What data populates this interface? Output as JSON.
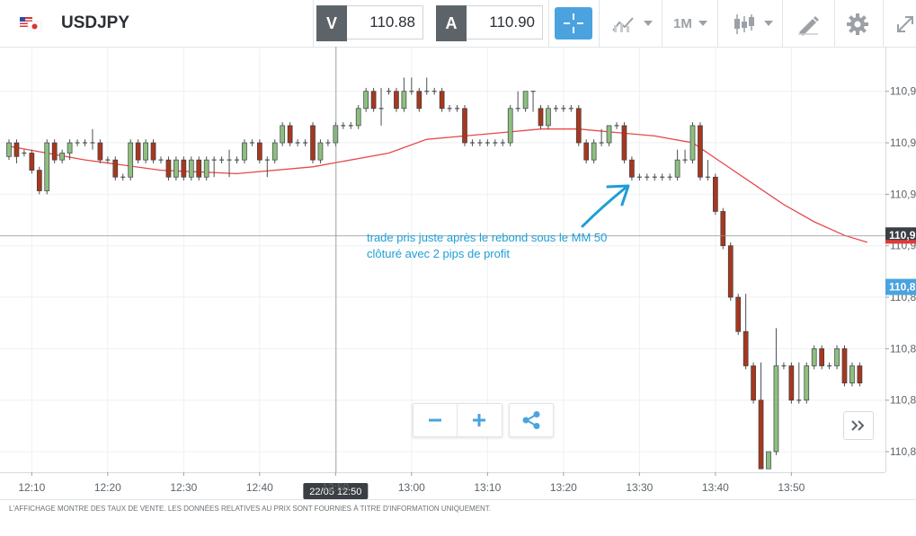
{
  "header": {
    "symbol": "USDJPY",
    "flag_icon": "us-jp-flag-icon",
    "sell": {
      "key": "V",
      "value": "110.88"
    },
    "buy": {
      "key": "A",
      "value": "110.90"
    },
    "timeframe": "1M",
    "icons": [
      "crosshair-icon",
      "indicators-icon",
      "candlestick-type-icon",
      "draw-icon",
      "gear-icon",
      "expand-icon"
    ]
  },
  "colors": {
    "accent": "#4aa3df",
    "bull": "#8fbf7f",
    "bear": "#a8371e",
    "ma": "#e8484a",
    "current_price": "#e53935",
    "annotation": "#1d9ed6"
  },
  "annotation": {
    "line1": "trade pris juste après le rebond sous le MM 50",
    "line2": "clôturé avec 2 pips de profit"
  },
  "crosshair": {
    "label": "22/05 12:50"
  },
  "price_tags": {
    "current": "110,9",
    "blue": "110,8"
  },
  "footer": {
    "disclaimer": "L'AFFICHAGE MONTRE DES TAUX DE VENTE. LES DONNÉES RELATIVES AU PRIX SONT FOURNIES À TITRE D'INFORMATION UNIQUEMENT."
  },
  "chart_data": {
    "type": "candlestick",
    "x_ticks": [
      "12:10",
      "12:20",
      "12:30",
      "12:40",
      "12:50",
      "13:00",
      "13:10",
      "13:20",
      "13:30",
      "13:40",
      "13:50"
    ],
    "y_ticks": [
      "110,9",
      "110,9",
      "110,9",
      "110,9",
      "110,8",
      "110,8",
      "110,8",
      "110,8"
    ],
    "y_tick_values": [
      110.935,
      110.92,
      110.905,
      110.89,
      110.875,
      110.86,
      110.845,
      110.83
    ],
    "ylim": [
      110.824,
      110.948
    ],
    "xlim_start": "12:07",
    "current_price": 110.893,
    "blue_price": 110.878,
    "crosshair_x": "12:50",
    "crosshair_y": 110.893,
    "grid": true,
    "ma_label": "MM 50",
    "ma": [
      [
        0,
        110.919
      ],
      [
        10,
        110.915
      ],
      [
        20,
        110.912
      ],
      [
        30,
        110.911
      ],
      [
        40,
        110.913
      ],
      [
        50,
        110.917
      ],
      [
        55,
        110.921
      ],
      [
        60,
        110.922
      ],
      [
        65,
        110.923
      ],
      [
        70,
        110.924
      ],
      [
        75,
        110.924
      ],
      [
        80,
        110.923
      ],
      [
        85,
        110.922
      ],
      [
        90,
        110.92
      ],
      [
        94,
        110.914
      ],
      [
        98,
        110.908
      ],
      [
        102,
        110.902
      ],
      [
        106,
        110.897
      ],
      [
        110,
        110.893
      ],
      [
        113,
        110.891
      ]
    ],
    "candles": [
      [
        0,
        110.916,
        110.92,
        110.921,
        110.915
      ],
      [
        1,
        110.92,
        110.916,
        110.921,
        110.914
      ],
      [
        2,
        110.917,
        110.917,
        110.918,
        110.916
      ],
      [
        3,
        110.917,
        110.912,
        110.918,
        110.911
      ],
      [
        4,
        110.912,
        110.906,
        110.913,
        110.905
      ],
      [
        5,
        110.906,
        110.92,
        110.921,
        110.905
      ],
      [
        6,
        110.92,
        110.915,
        110.921,
        110.914
      ],
      [
        7,
        110.915,
        110.917,
        110.918,
        110.914
      ],
      [
        8,
        110.917,
        110.92,
        110.921,
        110.915
      ],
      [
        9,
        110.92,
        110.92,
        110.921,
        110.919
      ],
      [
        10,
        110.92,
        110.92,
        110.921,
        110.919
      ],
      [
        11,
        110.92,
        110.92,
        110.924,
        110.918
      ],
      [
        12,
        110.92,
        110.915,
        110.921,
        110.914
      ],
      [
        13,
        110.915,
        110.915,
        110.916,
        110.914
      ],
      [
        14,
        110.915,
        110.91,
        110.916,
        110.909
      ],
      [
        15,
        110.91,
        110.91,
        110.911,
        110.909
      ],
      [
        16,
        110.91,
        110.92,
        110.921,
        110.909
      ],
      [
        17,
        110.92,
        110.915,
        110.921,
        110.914
      ],
      [
        18,
        110.915,
        110.92,
        110.921,
        110.914
      ],
      [
        19,
        110.92,
        110.915,
        110.921,
        110.914
      ],
      [
        20,
        110.915,
        110.915,
        110.916,
        110.914
      ],
      [
        21,
        110.915,
        110.91,
        110.916,
        110.909
      ],
      [
        22,
        110.91,
        110.915,
        110.916,
        110.909
      ],
      [
        23,
        110.915,
        110.91,
        110.916,
        110.909
      ],
      [
        24,
        110.91,
        110.915,
        110.916,
        110.909
      ],
      [
        25,
        110.915,
        110.91,
        110.916,
        110.909
      ],
      [
        26,
        110.91,
        110.915,
        110.916,
        110.909
      ],
      [
        27,
        110.915,
        110.915,
        110.916,
        110.91
      ],
      [
        28,
        110.915,
        110.915,
        110.916,
        110.914
      ],
      [
        29,
        110.915,
        110.915,
        110.918,
        110.91
      ],
      [
        30,
        110.915,
        110.915,
        110.916,
        110.914
      ],
      [
        31,
        110.915,
        110.92,
        110.921,
        110.914
      ],
      [
        32,
        110.92,
        110.92,
        110.921,
        110.919
      ],
      [
        33,
        110.92,
        110.915,
        110.921,
        110.914
      ],
      [
        34,
        110.915,
        110.915,
        110.916,
        110.91
      ],
      [
        35,
        110.915,
        110.92,
        110.921,
        110.914
      ],
      [
        36,
        110.92,
        110.925,
        110.926,
        110.919
      ],
      [
        37,
        110.925,
        110.92,
        110.926,
        110.919
      ],
      [
        38,
        110.92,
        110.92,
        110.921,
        110.919
      ],
      [
        39,
        110.92,
        110.92,
        110.921,
        110.919
      ],
      [
        40,
        110.925,
        110.915,
        110.926,
        110.914
      ],
      [
        41,
        110.915,
        110.92,
        110.921,
        110.914
      ],
      [
        42,
        110.92,
        110.92,
        110.921,
        110.919
      ],
      [
        43,
        110.92,
        110.925,
        110.926,
        110.919
      ],
      [
        44,
        110.925,
        110.925,
        110.926,
        110.924
      ],
      [
        45,
        110.925,
        110.925,
        110.926,
        110.924
      ],
      [
        46,
        110.925,
        110.93,
        110.931,
        110.924
      ],
      [
        47,
        110.93,
        110.935,
        110.936,
        110.929
      ],
      [
        48,
        110.935,
        110.93,
        110.936,
        110.929
      ],
      [
        49,
        110.93,
        110.93,
        110.936,
        110.925
      ],
      [
        50,
        110.935,
        110.935,
        110.936,
        110.934
      ],
      [
        51,
        110.935,
        110.93,
        110.936,
        110.929
      ],
      [
        52,
        110.93,
        110.935,
        110.939,
        110.929
      ],
      [
        53,
        110.935,
        110.935,
        110.939,
        110.934
      ],
      [
        54,
        110.935,
        110.93,
        110.936,
        110.929
      ],
      [
        55,
        110.935,
        110.935,
        110.939,
        110.934
      ],
      [
        56,
        110.935,
        110.935,
        110.936,
        110.934
      ],
      [
        57,
        110.935,
        110.93,
        110.936,
        110.929
      ],
      [
        58,
        110.93,
        110.93,
        110.931,
        110.929
      ],
      [
        59,
        110.93,
        110.93,
        110.931,
        110.929
      ],
      [
        60,
        110.93,
        110.92,
        110.931,
        110.919
      ],
      [
        61,
        110.92,
        110.92,
        110.921,
        110.919
      ],
      [
        62,
        110.92,
        110.92,
        110.921,
        110.919
      ],
      [
        63,
        110.92,
        110.92,
        110.921,
        110.919
      ],
      [
        64,
        110.92,
        110.92,
        110.921,
        110.919
      ],
      [
        65,
        110.92,
        110.92,
        110.921,
        110.919
      ],
      [
        66,
        110.92,
        110.93,
        110.931,
        110.919
      ],
      [
        67,
        110.93,
        110.93,
        110.935,
        110.929
      ],
      [
        68,
        110.93,
        110.935,
        110.935,
        110.929
      ],
      [
        69,
        110.935,
        110.935,
        110.935,
        110.929
      ],
      [
        70,
        110.93,
        110.925,
        110.931,
        110.924
      ],
      [
        71,
        110.925,
        110.93,
        110.931,
        110.924
      ],
      [
        72,
        110.93,
        110.93,
        110.931,
        110.929
      ],
      [
        73,
        110.93,
        110.93,
        110.931,
        110.929
      ],
      [
        74,
        110.93,
        110.93,
        110.931,
        110.929
      ],
      [
        75,
        110.93,
        110.92,
        110.931,
        110.919
      ],
      [
        76,
        110.92,
        110.915,
        110.921,
        110.914
      ],
      [
        77,
        110.915,
        110.92,
        110.921,
        110.914
      ],
      [
        78,
        110.92,
        110.92,
        110.924,
        110.919
      ],
      [
        79,
        110.92,
        110.925,
        110.925,
        110.919
      ],
      [
        80,
        110.925,
        110.925,
        110.926,
        110.924
      ],
      [
        81,
        110.925,
        110.915,
        110.926,
        110.914
      ],
      [
        82,
        110.915,
        110.91,
        110.916,
        110.909
      ],
      [
        83,
        110.91,
        110.91,
        110.911,
        110.909
      ],
      [
        84,
        110.91,
        110.91,
        110.911,
        110.909
      ],
      [
        85,
        110.91,
        110.91,
        110.911,
        110.909
      ],
      [
        86,
        110.91,
        110.91,
        110.911,
        110.909
      ],
      [
        87,
        110.91,
        110.91,
        110.911,
        110.909
      ],
      [
        88,
        110.91,
        110.915,
        110.918,
        110.909
      ],
      [
        89,
        110.915,
        110.915,
        110.918,
        110.914
      ],
      [
        90,
        110.915,
        110.925,
        110.926,
        110.914
      ],
      [
        91,
        110.925,
        110.91,
        110.926,
        110.909
      ],
      [
        92,
        110.91,
        110.91,
        110.915,
        110.909
      ],
      [
        93,
        110.91,
        110.9,
        110.911,
        110.899
      ],
      [
        94,
        110.9,
        110.89,
        110.901,
        110.889
      ],
      [
        95,
        110.89,
        110.875,
        110.891,
        110.874
      ],
      [
        96,
        110.875,
        110.865,
        110.876,
        110.864
      ],
      [
        97,
        110.865,
        110.855,
        110.876,
        110.854
      ],
      [
        98,
        110.855,
        110.845,
        110.856,
        110.844
      ],
      [
        99,
        110.845,
        110.825,
        110.856,
        110.825
      ],
      [
        100,
        110.825,
        110.83,
        110.83,
        110.825
      ],
      [
        101,
        110.83,
        110.855,
        110.866,
        110.829
      ],
      [
        102,
        110.855,
        110.855,
        110.856,
        110.854
      ],
      [
        103,
        110.855,
        110.845,
        110.856,
        110.844
      ],
      [
        104,
        110.845,
        110.845,
        110.856,
        110.844
      ],
      [
        105,
        110.845,
        110.855,
        110.856,
        110.844
      ],
      [
        106,
        110.855,
        110.86,
        110.861,
        110.854
      ],
      [
        107,
        110.86,
        110.855,
        110.861,
        110.854
      ],
      [
        108,
        110.855,
        110.855,
        110.856,
        110.854
      ],
      [
        109,
        110.855,
        110.86,
        110.861,
        110.854
      ],
      [
        110,
        110.86,
        110.85,
        110.861,
        110.849
      ],
      [
        111,
        110.85,
        110.855,
        110.856,
        110.849
      ],
      [
        112,
        110.855,
        110.85,
        110.856,
        110.849
      ]
    ]
  }
}
